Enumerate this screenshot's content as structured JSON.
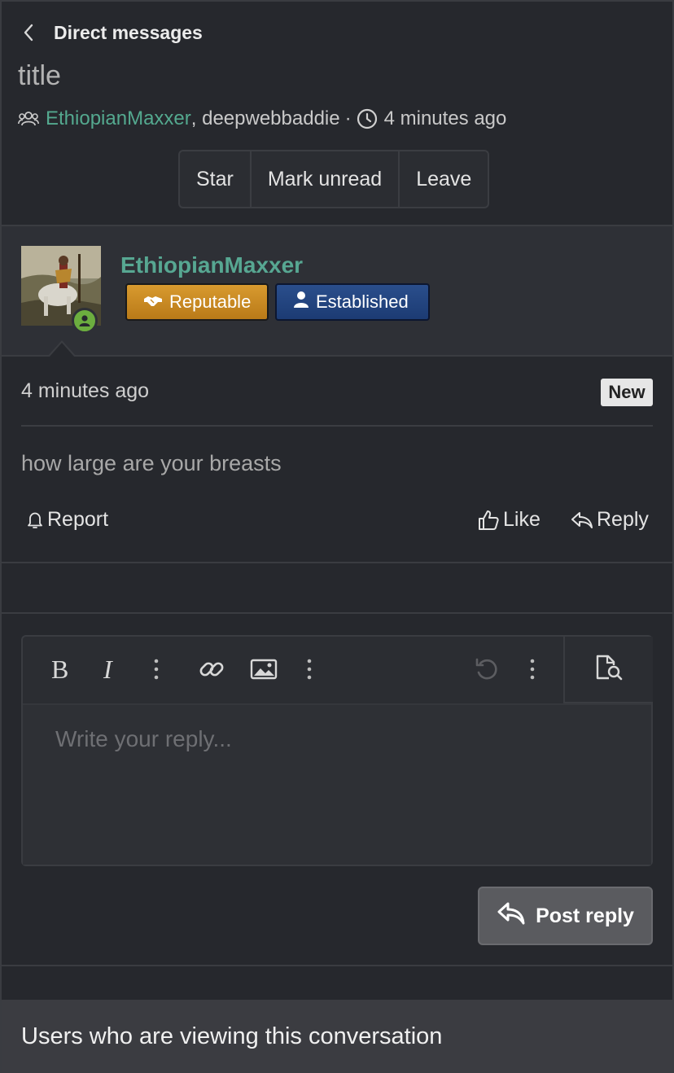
{
  "header": {
    "breadcrumb": "Direct messages",
    "title": "title",
    "participants": [
      "EthiopianMaxxer",
      "deepwebbaddie"
    ],
    "participant_separator": ", ",
    "dot": "·",
    "time": "4 minutes ago"
  },
  "actions": {
    "star": "Star",
    "mark_unread": "Mark unread",
    "leave": "Leave"
  },
  "message": {
    "author": "EthiopianMaxxer",
    "badges": {
      "reputable": "Reputable",
      "established": "Established"
    },
    "timestamp": "4 minutes ago",
    "new_label": "New",
    "text": "how large are your breasts",
    "report": "Report",
    "like": "Like",
    "reply": "Reply"
  },
  "editor": {
    "placeholder": "Write your reply...",
    "post_reply": "Post reply"
  },
  "footer": {
    "viewers_title": "Users who are viewing this conversation"
  },
  "colors": {
    "accent_green": "#54a98f",
    "reputable_badge": "#c98a24",
    "established_badge": "#233f79",
    "online": "#6cae3f"
  }
}
